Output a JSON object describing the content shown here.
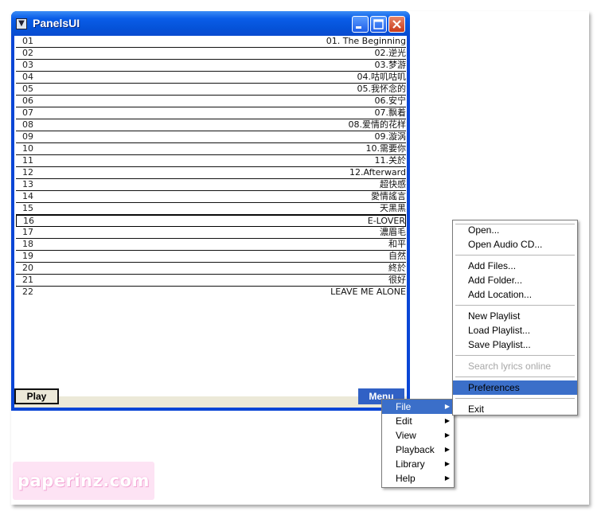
{
  "window": {
    "title": "PanelsUI",
    "min_icon": "minimize-icon",
    "max_icon": "maximize-icon",
    "close_icon": "close-icon"
  },
  "playlist": [
    {
      "num": "01",
      "title": "01. The Beginning"
    },
    {
      "num": "02",
      "title": "02.逆光"
    },
    {
      "num": "03",
      "title": "03.梦游"
    },
    {
      "num": "04",
      "title": "04.咕叽咕叽"
    },
    {
      "num": "05",
      "title": "05.我怀念的"
    },
    {
      "num": "06",
      "title": "06.安宁"
    },
    {
      "num": "07",
      "title": "07.飘着"
    },
    {
      "num": "08",
      "title": "08.爱情的花样"
    },
    {
      "num": "09",
      "title": "09.漩涡"
    },
    {
      "num": "10",
      "title": "10.需要你"
    },
    {
      "num": "11",
      "title": "11.关於"
    },
    {
      "num": "12",
      "title": "12.Afterward"
    },
    {
      "num": "13",
      "title": "超快感"
    },
    {
      "num": "14",
      "title": "愛情謠言"
    },
    {
      "num": "15",
      "title": "天黑黑"
    },
    {
      "num": "16",
      "title": "E-LOVER"
    },
    {
      "num": "17",
      "title": "濃眉毛"
    },
    {
      "num": "18",
      "title": "和平"
    },
    {
      "num": "19",
      "title": "自然"
    },
    {
      "num": "20",
      "title": "終於"
    },
    {
      "num": "21",
      "title": "很好"
    },
    {
      "num": "22",
      "title": "LEAVE ME ALONE"
    }
  ],
  "selected_row": "16",
  "buttons": {
    "play": "Play",
    "menu": "Menu"
  },
  "menu_main": [
    {
      "label": "File",
      "highlighted": true
    },
    {
      "label": "Edit"
    },
    {
      "label": "View"
    },
    {
      "label": "Playback"
    },
    {
      "label": "Library"
    },
    {
      "label": "Help"
    }
  ],
  "menu_file": {
    "open": "Open...",
    "open_cd": "Open Audio CD...",
    "add_files": "Add Files...",
    "add_folder": "Add Folder...",
    "add_location": "Add Location...",
    "new_playlist": "New Playlist",
    "load_playlist": "Load Playlist...",
    "save_playlist": "Save Playlist...",
    "search_lyrics": "Search lyrics online",
    "preferences": "Preferences",
    "exit": "Exit"
  },
  "watermark": "paperinz.com",
  "colors": {
    "title_bar": "#0a5de8",
    "highlight": "#3b6fc9",
    "menu_button": "#3161c5",
    "panel_bg": "#ece9d8"
  }
}
